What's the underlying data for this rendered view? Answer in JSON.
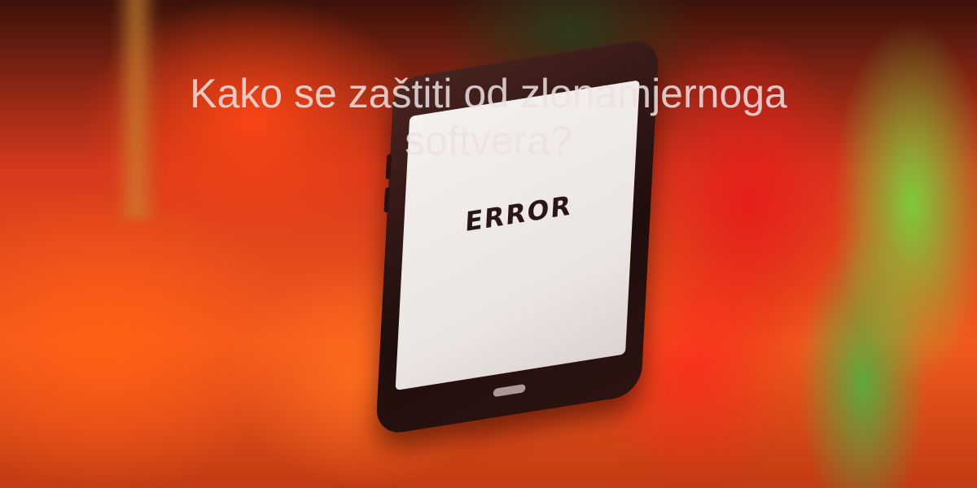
{
  "headline": {
    "text": "Kako se zaštiti od zlonamjernoga softvera?"
  },
  "photo": {
    "phone_screen_text": "ERROR",
    "accent_colors": {
      "background_orange": "#f15a1c",
      "background_red": "#e61e19",
      "background_green": "#78d23c",
      "screen": "#f4f0ee",
      "error_text": "#2a1616"
    }
  }
}
